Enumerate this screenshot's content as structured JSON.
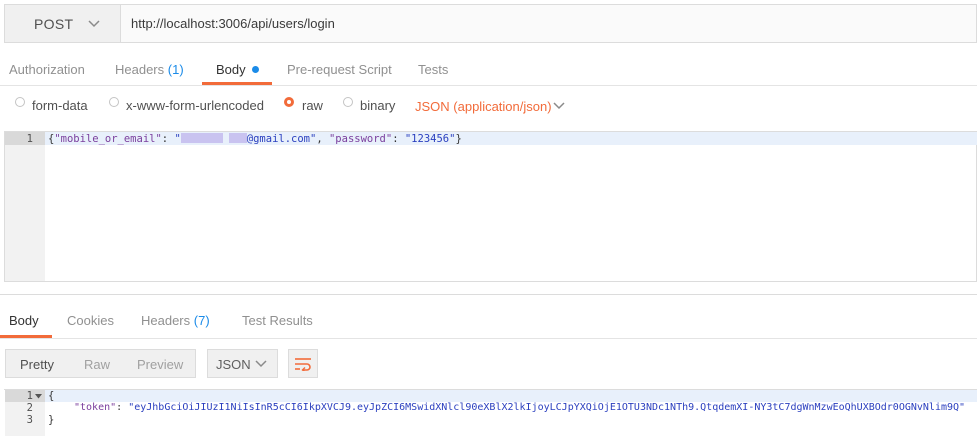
{
  "request": {
    "method": "POST",
    "url": "http://localhost:3006/api/users/login",
    "tabs": [
      {
        "label": "Authorization"
      },
      {
        "label": "Headers",
        "count": "(1)"
      },
      {
        "label": "Body"
      },
      {
        "label": "Pre-request Script"
      },
      {
        "label": "Tests"
      }
    ],
    "body_types": [
      {
        "label": "form-data",
        "selected": false
      },
      {
        "label": "x-www-form-urlencoded",
        "selected": false
      },
      {
        "label": "raw",
        "selected": true
      },
      {
        "label": "binary",
        "selected": false
      }
    ],
    "content_type": "JSON (application/json)",
    "editor": {
      "line_number": "1",
      "key1": "\"mobile_or_email\"",
      "value1_suffix": "@gmail.com\"",
      "key2": "\"password\"",
      "value2": "\"123456\""
    }
  },
  "response": {
    "tabs": [
      {
        "label": "Body"
      },
      {
        "label": "Cookies"
      },
      {
        "label": "Headers",
        "count": "(7)"
      },
      {
        "label": "Test Results"
      }
    ],
    "view_modes": [
      "Pretty",
      "Raw",
      "Preview"
    ],
    "format": "JSON",
    "lines": [
      "1",
      "2",
      "3"
    ],
    "open_brace": "{",
    "close_brace": "}",
    "token_key": "\"token\"",
    "token_value": "\"eyJhbGciOiJIUzI1NiIsInR5cCI6IkpXVCJ9.eyJpZCI6MSwidXNlcl90eXBlX2lkIjoyLCJpYXQiOjE1OTU3NDc1NTh9.QtqdemXI-NY3tC7dgWnMzwEoQhUXBOdr0OGNvNlim9Q\""
  },
  "colors": {
    "accent": "#f26b3a",
    "link": "#1b8be8"
  }
}
